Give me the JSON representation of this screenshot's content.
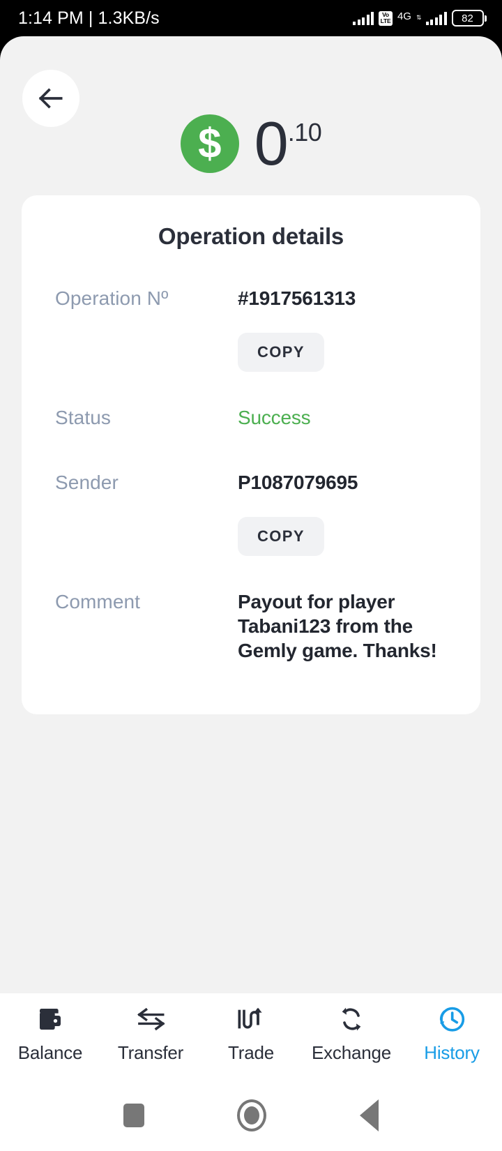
{
  "status_bar": {
    "time": "1:14 PM",
    "separator": "|",
    "network_speed": "1.3KB/s",
    "volte_line1": "Vo",
    "volte_line2": "LTE",
    "network_type": "4G",
    "data_arrows": "⇅",
    "battery_percent": "82"
  },
  "header": {
    "back_icon": "arrow-left-icon",
    "currency_icon": "dollar-coin-icon",
    "amount_integer": "0",
    "amount_decimal": ".10"
  },
  "card": {
    "title": "Operation details",
    "rows": [
      {
        "label": "Operation Nº",
        "value": "#1917561313",
        "copy_label": "COPY",
        "has_copy": true,
        "value_style": "bold"
      },
      {
        "label": "Status",
        "value": "Success",
        "has_copy": false,
        "value_style": "green"
      },
      {
        "label": "Sender",
        "value": "P1087079695",
        "copy_label": "COPY",
        "has_copy": true,
        "value_style": "bold"
      },
      {
        "label": "Comment",
        "value": "Payout for player Tabani123 from the Gemly game. Thanks!",
        "has_copy": false,
        "value_style": "bold"
      }
    ]
  },
  "tabbar": {
    "items": [
      {
        "label": "Balance",
        "icon": "wallet-icon",
        "active": false
      },
      {
        "label": "Transfer",
        "icon": "transfer-arrows-icon",
        "active": false
      },
      {
        "label": "Trade",
        "icon": "trade-chart-icon",
        "active": false
      },
      {
        "label": "Exchange",
        "icon": "exchange-loop-icon",
        "active": false
      },
      {
        "label": "History",
        "icon": "history-clock-icon",
        "active": true
      }
    ]
  },
  "system_nav": {
    "recents_icon": "square-recents-icon",
    "home_icon": "circle-home-icon",
    "back_icon": "triangle-back-icon"
  },
  "colors": {
    "accent_blue": "#189ce6",
    "success_green": "#4caf50",
    "label_gray": "#8d9aaf",
    "text_dark": "#22262f",
    "page_bg": "#f2f2f2"
  }
}
